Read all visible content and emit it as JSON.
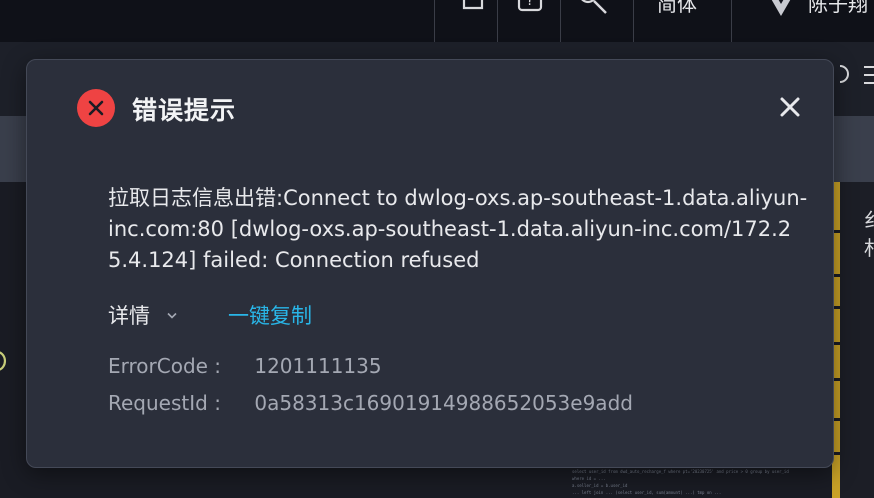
{
  "background": {
    "top_bar": {
      "language_label": "简体",
      "user_name": "陈子翔"
    },
    "code_lines": [
      "select user_id from dwd_auto_recharge_f where pt='20230725' and price > 0 group by user_id",
      "where id = ...",
      "a.seller_id = b.user_id",
      "",
      "... left join ... (select user_id, sum(amount) ...) tmp on ..."
    ],
    "right_glyphs": [
      "纟",
      "札"
    ]
  },
  "modal": {
    "icon": "error-x-circle-icon",
    "title": "错误提示",
    "close_icon": "close-icon",
    "message": "拉取日志信息出错:Connect to dwlog-oxs.ap-southeast-1.data.aliyun-inc.com:80 [dwlog-oxs.ap-southeast-1.data.aliyun-inc.com/172.25.4.124] failed: Connection refused",
    "details_label": "详情",
    "copy_label": "一键复制",
    "error_code_label": "ErrorCode :",
    "error_code_value": "1201111135",
    "request_id_label": "RequestId :",
    "request_id_value": "0a58313c16901914988652053e9add"
  },
  "colors": {
    "error_red": "#ef4343",
    "link_blue": "#29b6e8",
    "modal_bg": "#2b2f3b"
  }
}
